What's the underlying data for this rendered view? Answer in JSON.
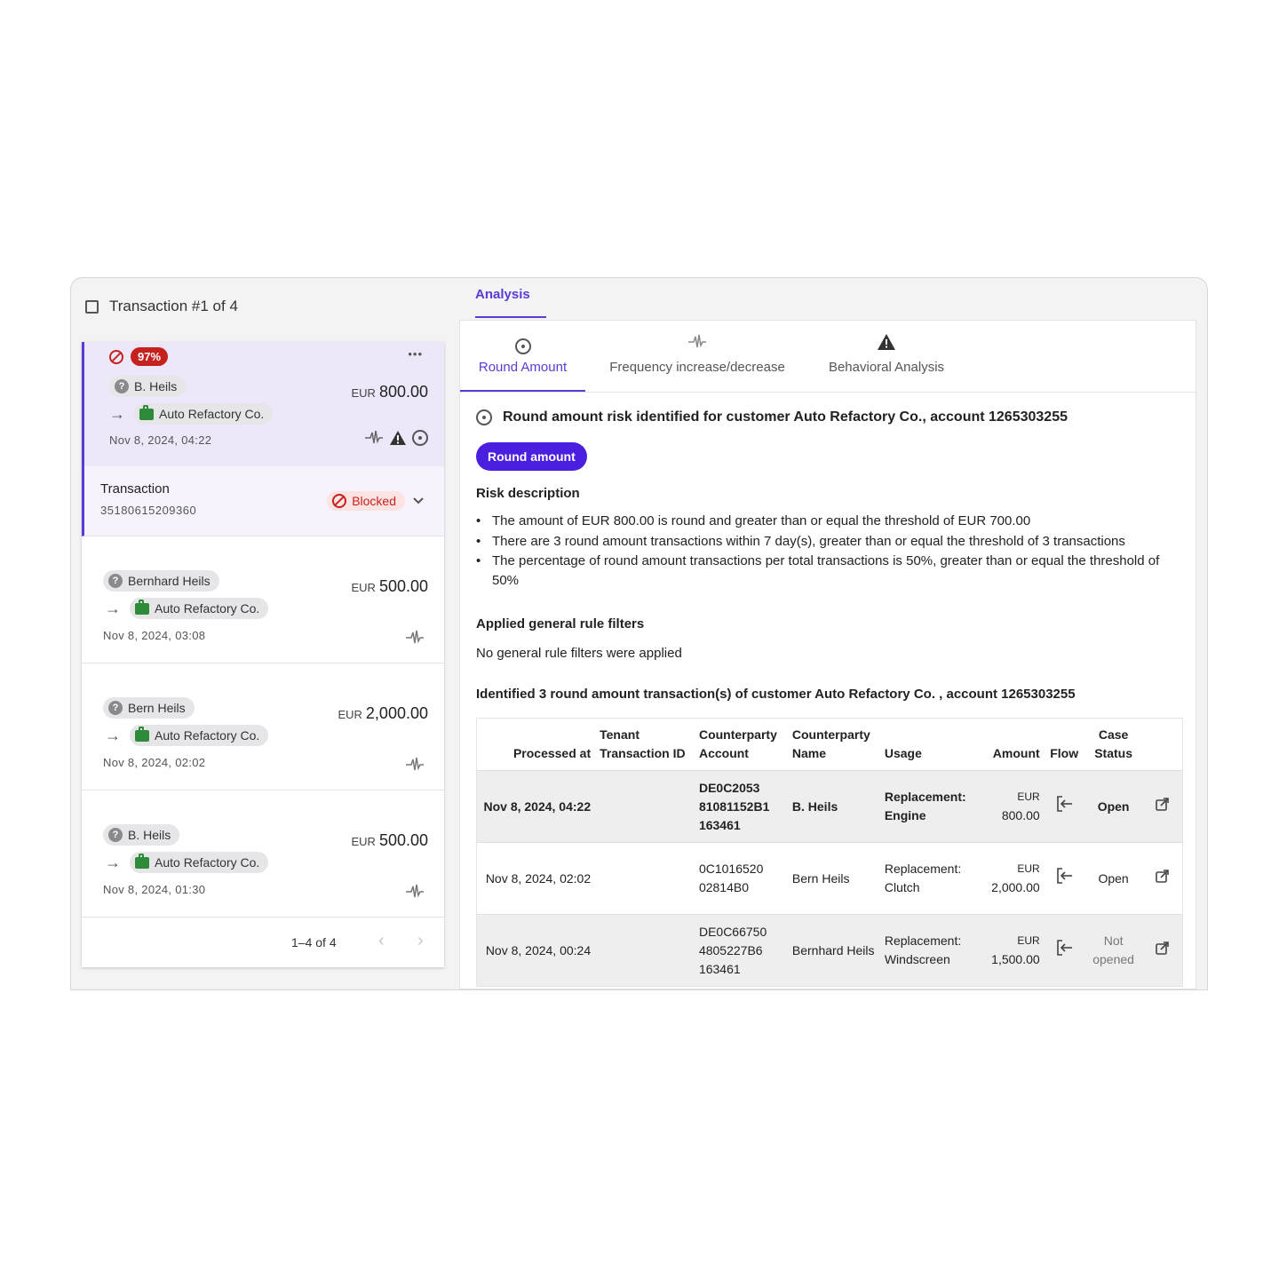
{
  "left": {
    "title": "Transaction #1 of 4",
    "selected": {
      "risk_score": "97%",
      "debtor": "B. Heils",
      "creditor": "Auto Refactory Co.",
      "date": "Nov 8, 2024, 04:22",
      "currency": "EUR",
      "amount": "800.00",
      "more": "•••",
      "detail_label": "Transaction",
      "detail_id": "35180615209360",
      "status": "Blocked"
    },
    "items": [
      {
        "debtor": "Bernhard Heils",
        "creditor": "Auto Refactory Co.",
        "date": "Nov 8, 2024, 03:08",
        "currency": "EUR",
        "amount": "500.00"
      },
      {
        "debtor": "Bern Heils",
        "creditor": "Auto Refactory Co.",
        "date": "Nov 8, 2024, 02:02",
        "currency": "EUR",
        "amount": "2,000.00"
      },
      {
        "debtor": "B. Heils",
        "creditor": "Auto Refactory Co.",
        "date": "Nov 8, 2024, 01:30",
        "currency": "EUR",
        "amount": "500.00"
      }
    ],
    "pager": {
      "range": "1–4 of 4",
      "prev": "‹",
      "next": "›"
    }
  },
  "right": {
    "top_tab": "Analysis",
    "subtabs": [
      "Round Amount",
      "Frequency increase/decrease",
      "Behavioral Analysis"
    ],
    "heading": "Round amount risk identified for customer Auto Refactory Co., account  1265303255",
    "pill": "Round amount",
    "risk_title": "Risk description",
    "bullets": [
      "The amount of EUR 800.00 is round and greater than or equal the threshold of EUR 700.00",
      "There are 3 round amount transactions within 7 day(s), greater than or equal the threshold of 3 transactions",
      "The percentage of round amount transactions per total transactions is 50%, greater than or equal the threshold of 50%"
    ],
    "filters_title": "Applied general rule filters",
    "filters_text": "No general rule filters were applied",
    "table_title": "Identified 3 round amount transaction(s) of customer Auto Refactory Co. , account  1265303255",
    "table": {
      "headers": [
        "Processed at",
        "Tenant Transaction ID",
        "Counterparty Account",
        "Counterparty Name",
        "Usage",
        "Amount",
        "Flow",
        "Case Status"
      ],
      "rows": [
        {
          "processed": "Nov 8, 2024, 04:22",
          "tenant": "",
          "account": "DE0C2053 81081152B1 163461",
          "name": "B. Heils",
          "usage": "Replacement: Engine",
          "currency": "EUR",
          "amount": "800.00",
          "status": "Open"
        },
        {
          "processed": "Nov 8, 2024, 02:02",
          "tenant": "",
          "account": "0C1016520 02814B0",
          "name": "Bern Heils",
          "usage": "Replacement: Clutch",
          "currency": "EUR",
          "amount": "2,000.00",
          "status": "Open"
        },
        {
          "processed": "Nov 8, 2024, 00:24",
          "tenant": "",
          "account": "DE0C66750 4805227B6 163461",
          "name": "Bernhard Heils",
          "usage": "Replacement: Windscreen",
          "currency": "EUR",
          "amount": "1,500.00",
          "status": "Not opened"
        }
      ]
    }
  },
  "icons": {
    "pulse": "pulse-icon",
    "warning": "warning-icon",
    "target": "target-icon",
    "flow": "flow-in-icon",
    "external": "external-link-icon"
  },
  "colors": {
    "accent": "#5b3ad6",
    "pill": "#4a1fe0",
    "danger": "#c5221f",
    "selected_bg": "#ece8fa"
  }
}
